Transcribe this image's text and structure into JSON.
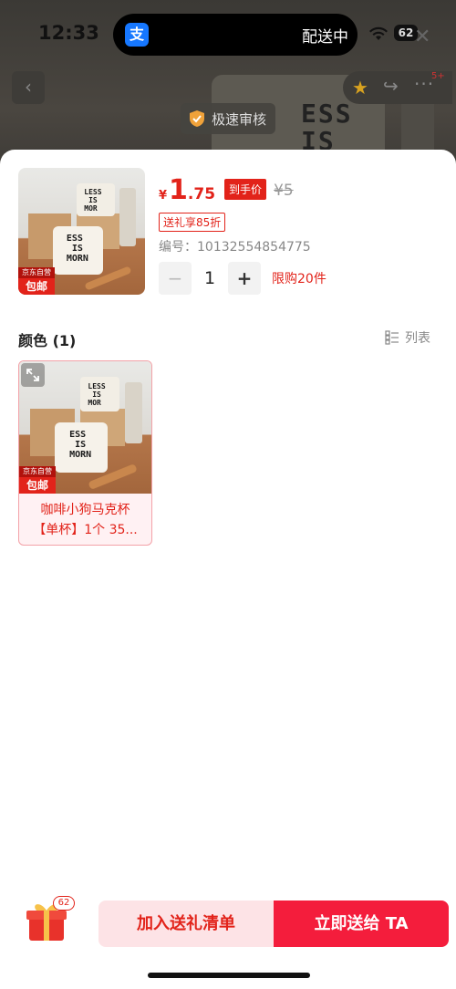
{
  "status_bar": {
    "time": "12:33",
    "island_app_icon": "支",
    "island_text": "配送中",
    "battery": "62"
  },
  "background_page": {
    "mug_text": "ESS\nIS",
    "audit_badge": "极速审核",
    "nav_more_badge": "5+"
  },
  "sheet": {
    "product": {
      "thumb_tag_small": "京东自营",
      "thumb_tag_main": "包邮",
      "currency": "¥",
      "price_int": "1",
      "price_dec": ".75",
      "price_tag": "到手价",
      "price_old": "¥5",
      "gift_discount": "送礼享85折",
      "item_number": "编号：10132554854775",
      "quantity": "1",
      "qty_minus": "−",
      "qty_plus": "+",
      "limit": "限购20件",
      "photo_text": "ESS\n IS\nMORN",
      "photo_text_small": "LESS\n IS\nMOR"
    },
    "color_section": {
      "title": "颜色 (1)",
      "list_toggle": "列表"
    },
    "variants": [
      {
        "tag_small": "京东自营",
        "tag_main": "包邮",
        "name_line1": "咖啡小狗马克杯",
        "name_line2": "【单杯】1个 35..."
      }
    ]
  },
  "action_bar": {
    "gift_badge": "62",
    "add_button": "加入送礼清单",
    "send_button": "立即送给 TA"
  },
  "colors": {
    "accent": "#e2231a",
    "send_button": "#f41d3c",
    "add_button_bg": "#fde3e6"
  },
  "icons": [
    "back-icon",
    "star-icon",
    "share-icon",
    "more-icon",
    "shield-check-icon",
    "wifi-icon",
    "close-icon",
    "list-icon",
    "expand-icon",
    "gift-box-icon"
  ]
}
